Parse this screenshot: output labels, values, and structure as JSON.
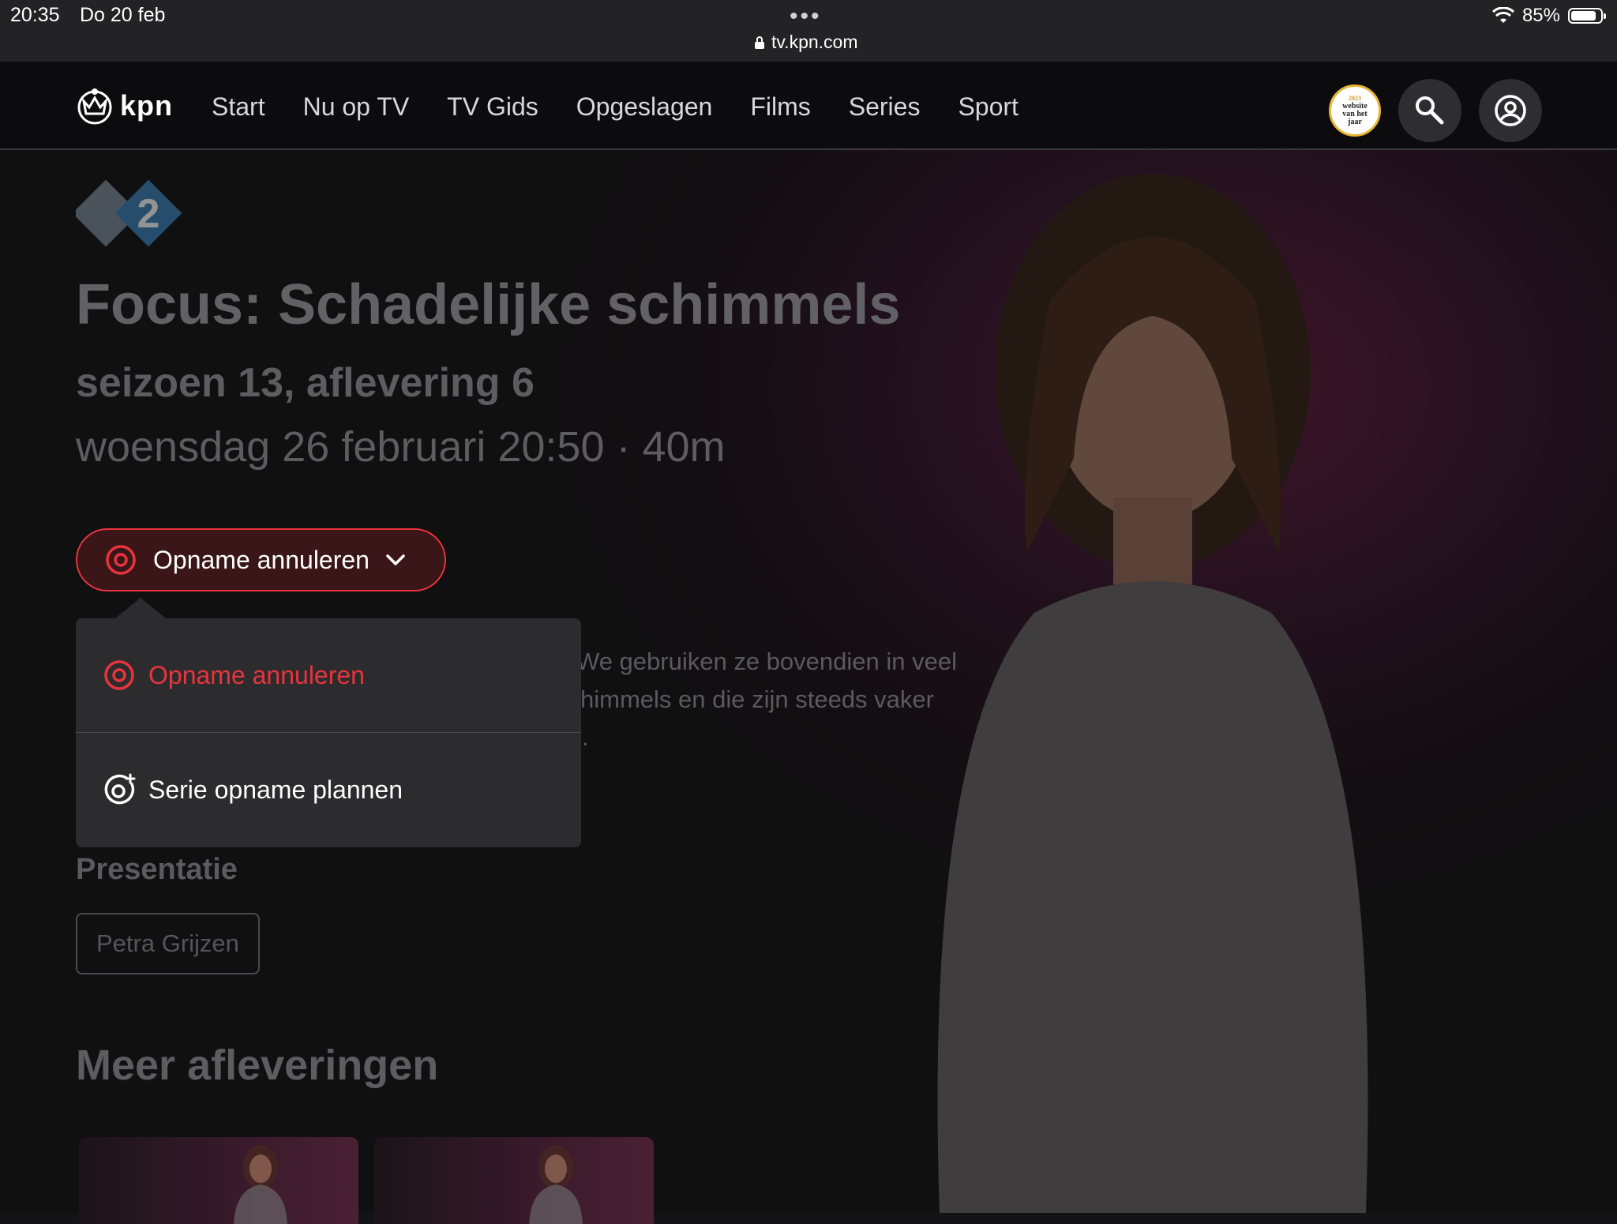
{
  "status_bar": {
    "time": "20:35",
    "date": "Do 20 feb",
    "url": "tv.kpn.com",
    "battery": "85%",
    "battery_level": 0.85
  },
  "nav": {
    "logo": "kpn",
    "items": [
      "Start",
      "Nu op TV",
      "TV Gids",
      "Opgeslagen",
      "Films",
      "Series",
      "Sport"
    ],
    "award_lines": [
      "2023",
      "website",
      "van het",
      "jaar"
    ]
  },
  "program": {
    "channel": "npo 2",
    "title": "Focus: Schadelijke schimmels",
    "episode": "seizoen 13, aflevering 6",
    "datetime": "woensdag 26 februari 20:50 · 40m",
    "description_lines": [
      "We gebruiken ze bovendien in veel",
      "himmels en die zijn steeds vaker",
      "."
    ]
  },
  "record_button": {
    "label": "Opname annuleren",
    "accent": "#e8343c"
  },
  "dropdown": {
    "items": [
      {
        "label": "Opname annuleren",
        "icon": "record-icon"
      },
      {
        "label": "Serie opname plannen",
        "icon": "record-plus-icon"
      }
    ]
  },
  "cast": {
    "heading": "Presentatie",
    "people": [
      "Petra Grijzen"
    ]
  },
  "more": {
    "heading": "Meer afleveringen"
  }
}
